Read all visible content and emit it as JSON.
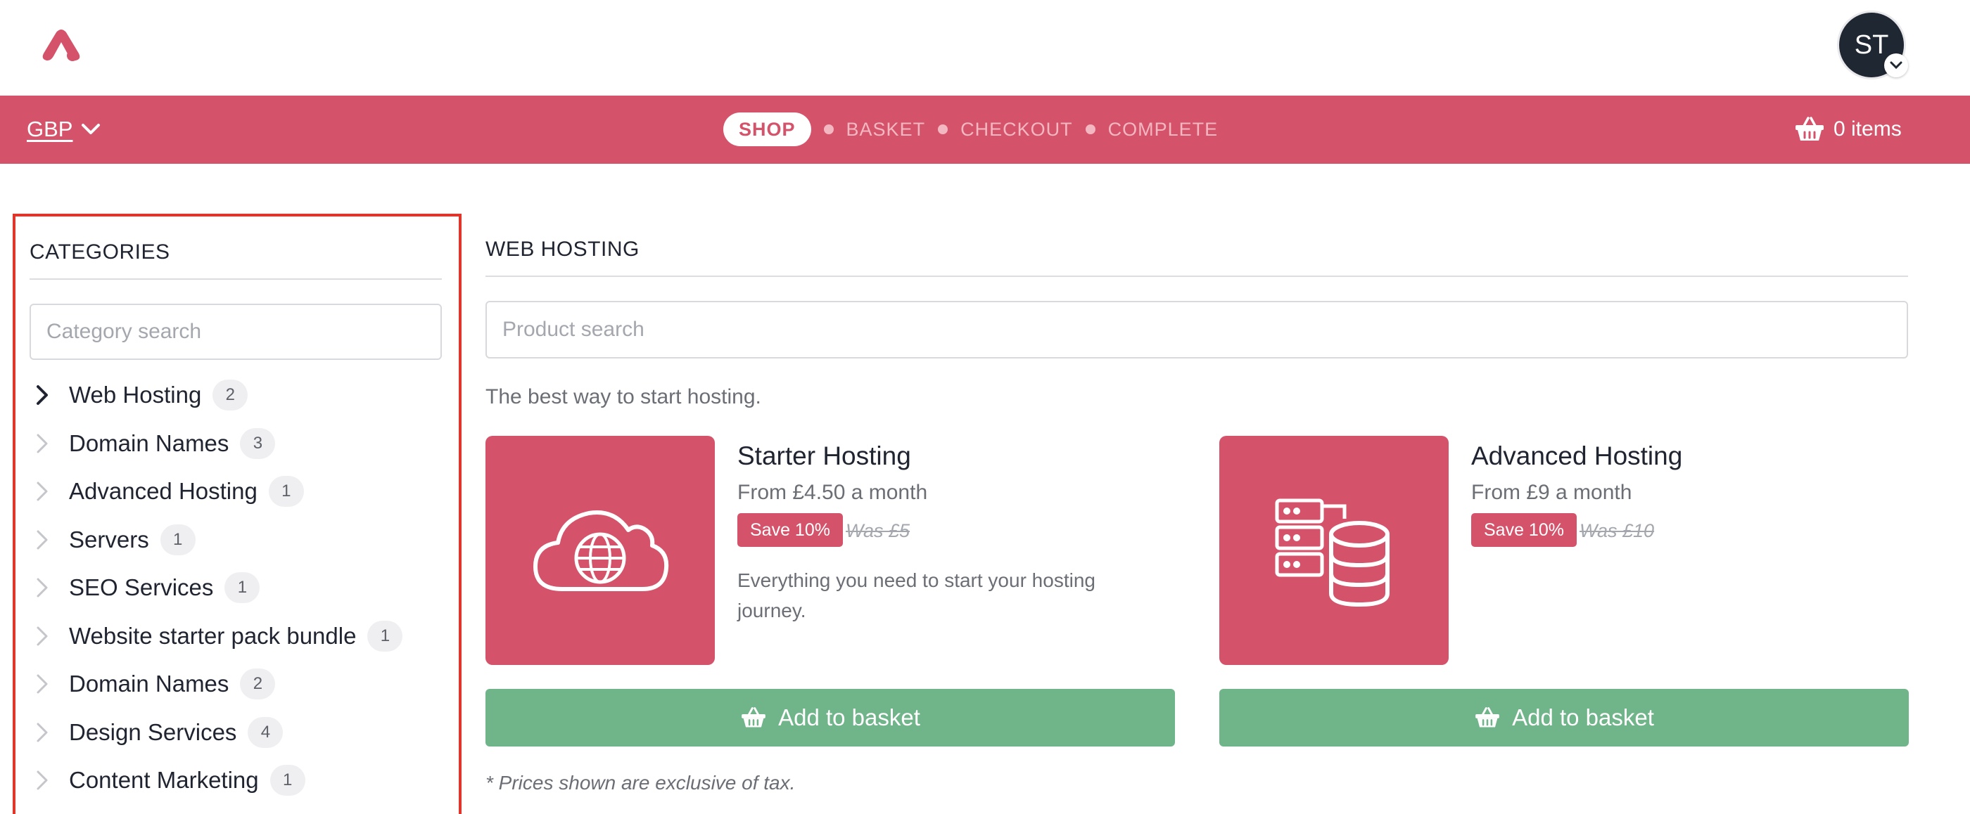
{
  "colors": {
    "brand": "#d5536a",
    "success": "#70b48a",
    "sidebar_highlight_border": "#e0352b",
    "avatar_bg": "#1f2733"
  },
  "header": {
    "logo_icon": "brand-logo-icon",
    "avatar_initials": "ST",
    "avatar_menu_icon": "chevron-down-icon"
  },
  "nav": {
    "currency": "GBP",
    "steps": {
      "shop": "SHOP",
      "basket": "BASKET",
      "checkout": "CHECKOUT",
      "complete": "COMPLETE"
    },
    "active_step": "SHOP",
    "basket_count": "0 items",
    "basket_icon": "basket-icon"
  },
  "sidebar": {
    "title": "CATEGORIES",
    "search_placeholder": "Category search",
    "categories": [
      {
        "label": "Web Hosting",
        "count": "2",
        "active": true
      },
      {
        "label": "Domain Names",
        "count": "3"
      },
      {
        "label": "Advanced Hosting",
        "count": "1"
      },
      {
        "label": "Servers",
        "count": "1"
      },
      {
        "label": "SEO Services",
        "count": "1"
      },
      {
        "label": "Website starter pack bundle",
        "count": "1"
      },
      {
        "label": "Domain Names",
        "count": "2"
      },
      {
        "label": "Design Services",
        "count": "4"
      },
      {
        "label": "Content Marketing",
        "count": "1"
      }
    ]
  },
  "main": {
    "title": "WEB HOSTING",
    "search_placeholder": "Product search",
    "intro": "The best way to start hosting.",
    "products": [
      {
        "name": "Starter Hosting",
        "price": "From £4.50 a month",
        "save": "Save 10%",
        "was": "Was £5",
        "description": "Everything you need to start your hosting journey.",
        "icon": "cloud-globe-icon",
        "button": "Add to basket"
      },
      {
        "name": "Advanced Hosting",
        "price": "From £9 a month",
        "save": "Save 10%",
        "was": "Was £10",
        "description": "",
        "icon": "server-database-icon",
        "button": "Add to basket"
      }
    ],
    "tax_note": "* Prices shown are exclusive of tax."
  }
}
